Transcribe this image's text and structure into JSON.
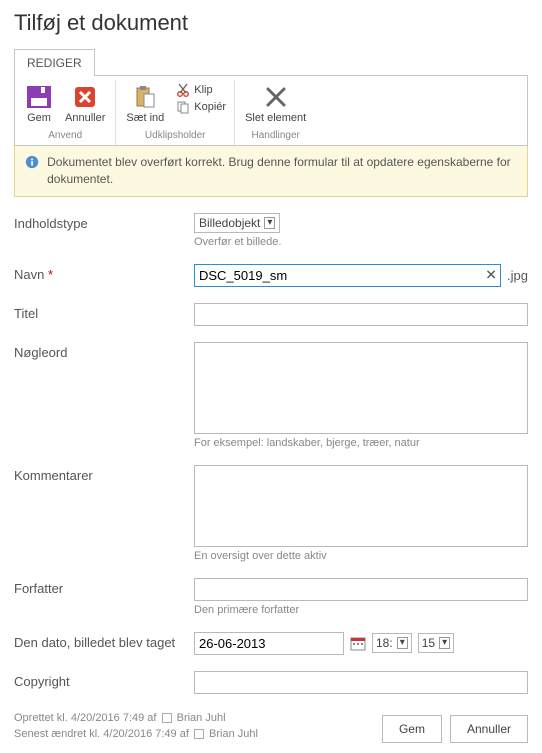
{
  "page": {
    "title": "Tilføj et dokument"
  },
  "tabs": {
    "editor": "REDIGER"
  },
  "ribbon": {
    "apply_group": "Anvend",
    "apply": {
      "save": "Gem",
      "cancel": "Annuller"
    },
    "clipboard_group": "Udklipsholder",
    "clipboard": {
      "paste": "Sæt ind",
      "cut": "Klip",
      "copy": "Kopiér"
    },
    "actions_group": "Handlinger",
    "actions": {
      "delete": "Slet element"
    }
  },
  "info": {
    "message": "Dokumentet blev overført korrekt. Brug denne formular til at opdatere egenskaberne for dokumentet."
  },
  "form": {
    "contentType": {
      "label": "Indholdstype",
      "value": "Billedobjekt",
      "helper": "Overfør et billede."
    },
    "name": {
      "label": "Navn",
      "required": "*",
      "value": "DSC_5019_sm",
      "extension": ".jpg"
    },
    "title": {
      "label": "Titel",
      "value": ""
    },
    "keywords": {
      "label": "Nøgleord",
      "value": "",
      "helper": "For eksempel: landskaber, bjerge, træer, natur"
    },
    "comments": {
      "label": "Kommentarer",
      "value": "",
      "helper": "En oversigt over dette aktiv"
    },
    "author": {
      "label": "Forfatter",
      "value": "",
      "helper": "Den primære forfatter"
    },
    "dateTaken": {
      "label": "Den dato, billedet blev taget",
      "date": "26-06-2013",
      "hour": "18:",
      "minute": "15"
    },
    "copyright": {
      "label": "Copyright",
      "value": ""
    }
  },
  "meta": {
    "created": "Oprettet kl. 4/20/2016 7:49  af",
    "modified": "Senest ændret kl. 4/20/2016 7:49  af",
    "user": "Brian Juhl"
  },
  "footer": {
    "save": "Gem",
    "cancel": "Annuller"
  }
}
